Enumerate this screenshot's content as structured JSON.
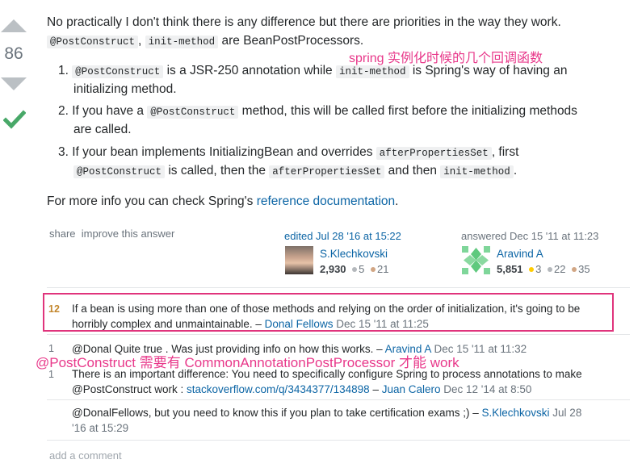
{
  "vote": {
    "score": "86"
  },
  "answer": {
    "intro_line1": "No practically I don't think there is any difference but there are priorities in the way they work.",
    "intro_code1": "@PostConstruct",
    "intro_comma": ",",
    "intro_code2": "init-method",
    "intro_tail": "are BeanPostProcessors.",
    "items": [
      {
        "num": "1.",
        "code1": "@PostConstruct",
        "t1": "is a JSR-250 annotation while",
        "code2": "init-method",
        "t2": "is Spring's way of having an",
        "t3": "initializing method."
      },
      {
        "num": "2.",
        "t1": "If you have a",
        "code1": "@PostConstruct",
        "t2": "method, this will be called first before the initializing methods",
        "t3": "are called."
      },
      {
        "num": "3.",
        "t1": "If your bean implements InitializingBean and overrides",
        "code1": "afterPropertiesSet",
        "t2": ", first",
        "code2": "@PostConstruct",
        "t3": "is called, then the",
        "code3": "afterPropertiesSet",
        "t4": "and then",
        "code4": "init-method",
        "t5": "."
      }
    ],
    "more_info_prefix": "For more info you can check Spring's",
    "more_info_link": "reference documentation",
    "more_info_suffix": "."
  },
  "annotations": {
    "top": "spring 实例化时候的几个回调函数",
    "middle": "@PostConstruct 需要有 CommonAnnotationPostProcessor 才能 work"
  },
  "post_menu": {
    "share": "share",
    "improve": "improve this answer"
  },
  "edited": {
    "label": "edited Jul 28 '16 at 15:22",
    "user": "S.Klechkovski",
    "rep": "2,930",
    "silver": "5",
    "bronze": "21"
  },
  "answered": {
    "label": "answered Dec 15 '11 at 11:23",
    "user": "Aravind A",
    "rep": "5,851",
    "gold": "3",
    "silver": "22",
    "bronze": "35"
  },
  "comments": [
    {
      "score": "12",
      "text1": "If a bean is using more than one of those methods and relying on the order of initialization, it's going to be",
      "text2": "horribly complex and unmaintainable. –",
      "user": "Donal Fellows",
      "date": "Dec 15 '11 at 11:25"
    },
    {
      "score": "1",
      "text": "@Donal Quite true . Was just providing info on how this works. –",
      "user": "Aravind A",
      "date": "Dec 15 '11 at 11:32"
    },
    {
      "score": "1",
      "text1": "There is an important difference: You need to specifically configure Spring to process annotations to make",
      "text2": "@PostConstruct work :",
      "link": "stackoverflow.com/q/3434377/134898",
      "dash": "–",
      "user": "Juan Calero",
      "date": "Dec 12 '14 at 8:50"
    },
    {
      "score": "",
      "text1": "@DonalFellows, but you need to know this if you plan to take certification exams ;) –",
      "user": "S.Klechkovski",
      "date1": "Jul 28",
      "date2": "'16 at 15:29"
    }
  ],
  "add_comment": "add a comment",
  "colors": {
    "gold": "#ffcc01",
    "silver": "#b4b8bc",
    "bronze": "#d1a684",
    "accent_pink": "#e8388a",
    "highlight_border": "#e0347c",
    "link": "#0c65a5"
  }
}
